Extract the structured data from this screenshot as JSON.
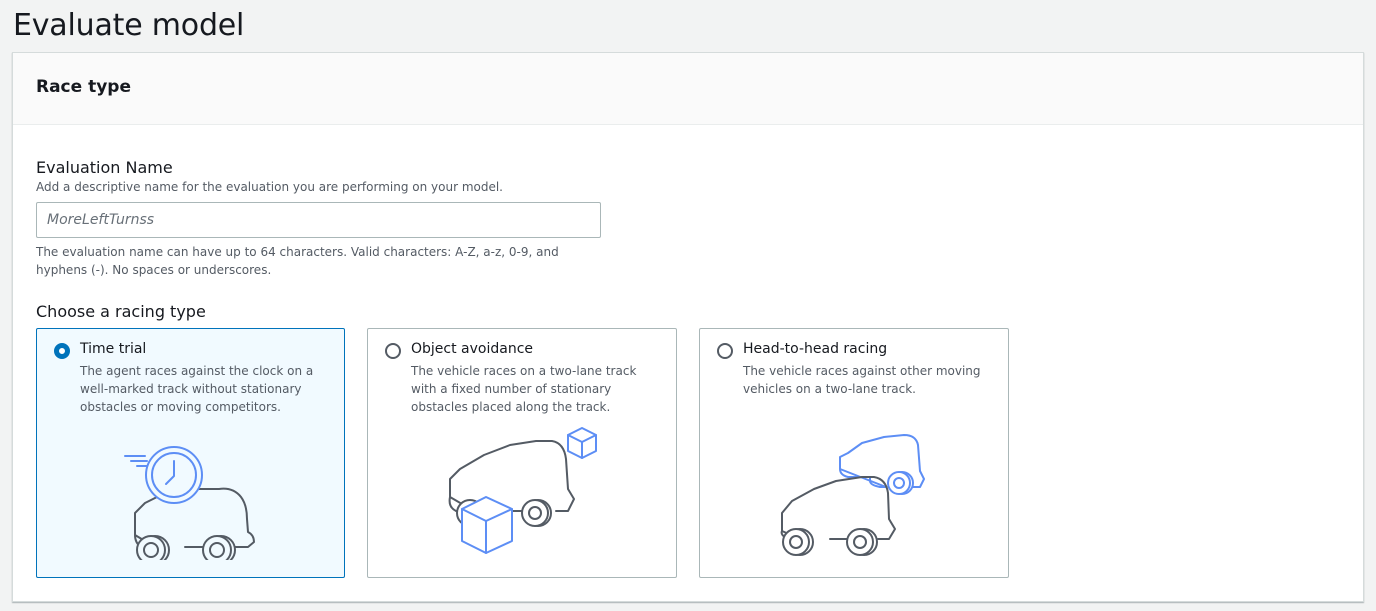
{
  "page": {
    "title": "Evaluate model"
  },
  "panel": {
    "title": "Race type"
  },
  "evaluation_name": {
    "label": "Evaluation Name",
    "description": "Add a descriptive name for the evaluation you are performing on your model.",
    "placeholder": "MoreLeftTurnss",
    "value": "",
    "constraint": "The evaluation name can have up to 64 characters. Valid characters: A-Z, a-z, 0-9, and hyphens (-). No spaces or underscores."
  },
  "racing_type": {
    "label": "Choose a racing type",
    "options": [
      {
        "title": "Time trial",
        "description": "The agent races against the clock on a well-marked track without stationary obstacles or moving competitors.",
        "selected": true,
        "icon": "time-trial-car-icon"
      },
      {
        "title": "Object avoidance",
        "description": "The vehicle races on a two-lane track with a fixed number of stationary obstacles placed along the track.",
        "selected": false,
        "icon": "object-avoidance-car-icon"
      },
      {
        "title": "Head-to-head racing",
        "description": "The vehicle races against other moving vehicles on a two-lane track.",
        "selected": false,
        "icon": "head-to-head-cars-icon"
      }
    ]
  },
  "colors": {
    "accent": "#0073bb",
    "illustration_blue": "#5d8ef5",
    "illustration_gray": "#545b64"
  }
}
